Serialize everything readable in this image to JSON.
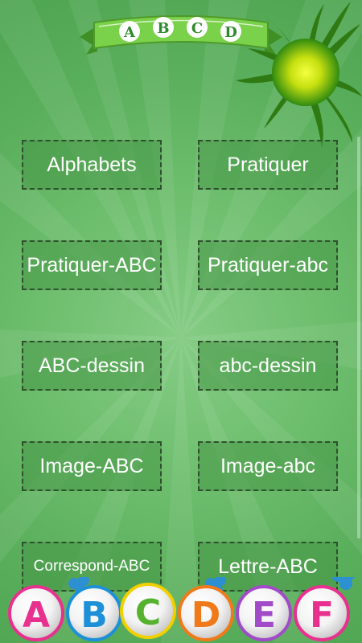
{
  "header": {
    "letters": [
      "A",
      "B",
      "C",
      "D"
    ]
  },
  "menu": {
    "items": [
      {
        "label": "Alphabets"
      },
      {
        "label": "Pratiquer"
      },
      {
        "label": "Pratiquer-ABC"
      },
      {
        "label": "Pratiquer-abc"
      },
      {
        "label": "ABC-dessin"
      },
      {
        "label": "abc-dessin"
      },
      {
        "label": "Image-ABC"
      },
      {
        "label": "Image-abc"
      },
      {
        "label": "Correspond-ABC"
      },
      {
        "label": "Lettre-ABC"
      }
    ]
  },
  "footer": {
    "balls": [
      {
        "letter": "A",
        "color": "#e8318f"
      },
      {
        "letter": "B",
        "color": "#1e90d8"
      },
      {
        "letter": "C",
        "color": "#56b12f"
      },
      {
        "letter": "D",
        "color": "#f07a1a"
      },
      {
        "letter": "E",
        "color": "#a24bc9"
      },
      {
        "letter": "F",
        "color": "#e8318f"
      }
    ]
  },
  "colors": {
    "background": "#6fbf6f",
    "button_fill": "#4f9a4f",
    "button_border": "#2f4f2f",
    "banner_ribbon": "#7ad14a",
    "sun_core": "#e8f200"
  }
}
